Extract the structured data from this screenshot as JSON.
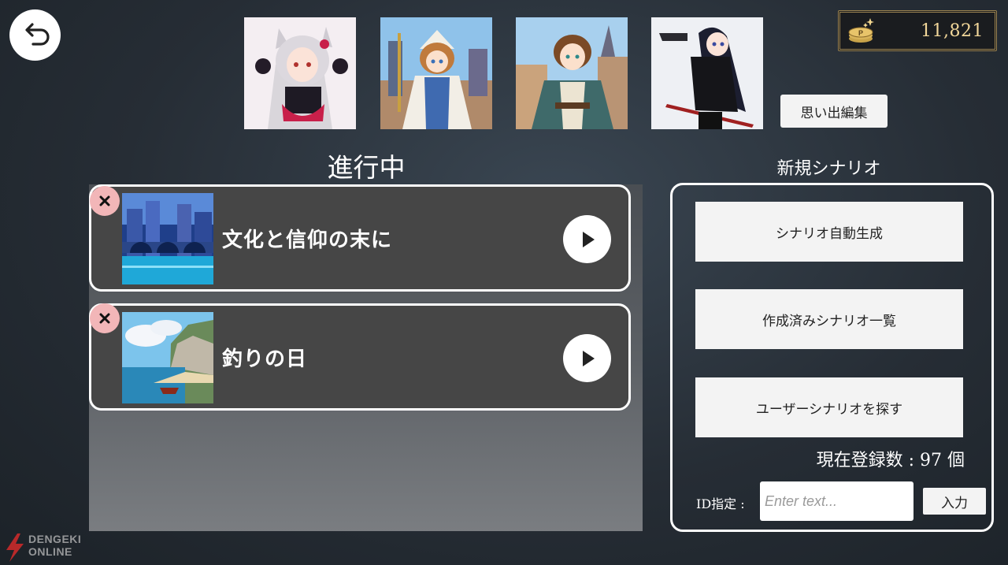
{
  "header": {
    "coins": "11,821",
    "memories_button": "思い出編集"
  },
  "characters": [
    {
      "icon": "cat-girl-portrait"
    },
    {
      "icon": "priestess-portrait"
    },
    {
      "icon": "young-hero-portrait"
    },
    {
      "icon": "gunslinger-portrait"
    }
  ],
  "ongoing": {
    "title": "進行中",
    "items": [
      {
        "title": "文化と信仰の末に",
        "thumb": "canal-city-thumbnail"
      },
      {
        "title": "釣りの日",
        "thumb": "seaside-cliff-thumbnail"
      }
    ]
  },
  "new_scenario": {
    "title": "新規シナリオ",
    "auto_generate": "シナリオ自動生成",
    "created_list": "作成済みシナリオ一覧",
    "search_user": "ユーザーシナリオを探す",
    "registered_count": "現在登録数 : 97 個",
    "id_label": "ID指定 :",
    "id_placeholder": "Enter text...",
    "submit": "入力"
  },
  "watermark": {
    "line1": "DENGEKI",
    "line2": "ONLINE"
  },
  "colors": {
    "accent_gold": "#9b8350",
    "delete_pink": "#f2b6b8",
    "card_bg": "#464646"
  }
}
